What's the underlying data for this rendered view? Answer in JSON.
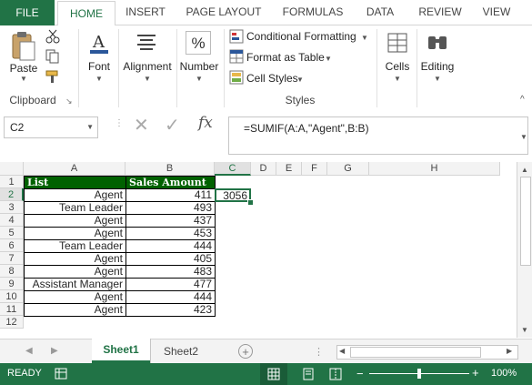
{
  "ribbon_tabs": [
    "FILE",
    "HOME",
    "INSERT",
    "PAGE LAYOUT",
    "FORMULAS",
    "DATA",
    "REVIEW",
    "VIEW"
  ],
  "clipboard": {
    "paste": "Paste",
    "group": "Clipboard"
  },
  "font": {
    "label": "Font"
  },
  "alignment": {
    "label": "Alignment"
  },
  "number": {
    "label": "Number"
  },
  "styles": {
    "conditional": "Conditional Formatting",
    "format_table": "Format as Table",
    "cell_styles": "Cell Styles",
    "group": "Styles"
  },
  "cells": {
    "label": "Cells"
  },
  "editing": {
    "label": "Editing"
  },
  "formula_bar": {
    "name_box": "C2",
    "fx": "fx",
    "formula": "=SUMIF(A:A,\"Agent\",B:B)"
  },
  "columns": [
    "A",
    "B",
    "C",
    "D",
    "E",
    "F",
    "G",
    "H"
  ],
  "rows": [
    "1",
    "2",
    "3",
    "4",
    "5",
    "6",
    "7",
    "8",
    "9",
    "10",
    "11",
    "12"
  ],
  "table": {
    "header": [
      "List",
      "Sales Amount"
    ],
    "rows": [
      [
        "Agent",
        "411"
      ],
      [
        "Team Leader",
        "493"
      ],
      [
        "Agent",
        "437"
      ],
      [
        "Agent",
        "453"
      ],
      [
        "Team Leader",
        "444"
      ],
      [
        "Agent",
        "405"
      ],
      [
        "Agent",
        "483"
      ],
      [
        "Assistant Manager",
        "477"
      ],
      [
        "Agent",
        "444"
      ],
      [
        "Agent",
        "423"
      ]
    ]
  },
  "result_cell": "3056",
  "sheets": [
    "Sheet1",
    "Sheet2"
  ],
  "status": {
    "mode": "READY",
    "zoom": "100%"
  },
  "colors": {
    "accent": "#217346",
    "header_fill": "#006100"
  }
}
